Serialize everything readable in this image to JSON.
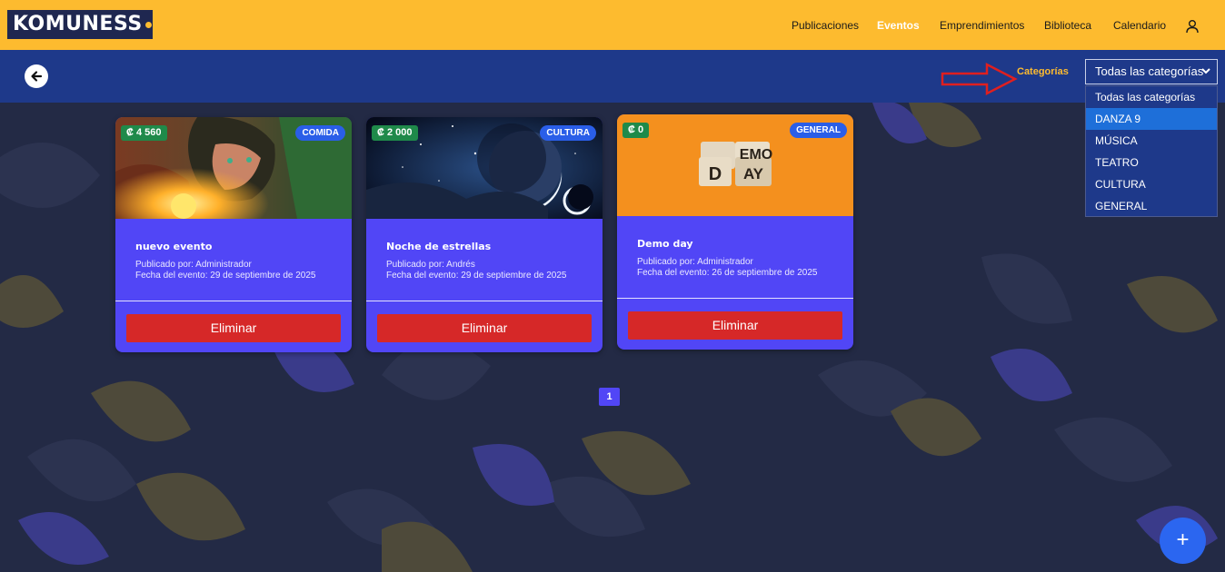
{
  "brand": {
    "logo_text": "KOMUNESS"
  },
  "nav": {
    "items": [
      "Publicaciones",
      "Eventos",
      "Emprendimientos",
      "Biblioteca",
      "Calendario"
    ],
    "active": "Eventos"
  },
  "filter": {
    "label": "Categorías",
    "selected": "Todas las categorías",
    "options": [
      "Todas las categorías",
      "DANZA 9",
      "MÚSICA",
      "TEATRO",
      "CULTURA",
      "GENERAL"
    ],
    "highlighted": "DANZA 9"
  },
  "events": [
    {
      "price": "₡ 4 560",
      "category": "COMIDA",
      "title": "nuevo evento",
      "published_by": "Publicado por: Administrador",
      "date": "Fecha del evento: 29 de septiembre de 2025",
      "delete_label": "Eliminar"
    },
    {
      "price": "₡ 2 000",
      "category": "CULTURA",
      "title": "Noche de estrellas",
      "published_by": "Publicado por: Andrés",
      "date": "Fecha del evento: 29 de septiembre de 2025",
      "delete_label": "Eliminar"
    },
    {
      "price": "₡ 0",
      "category": "GENERAL",
      "title": "Demo day",
      "published_by": "Publicado por: Administrador",
      "date": "Fecha del evento: 26 de septiembre de 2025",
      "delete_label": "Eliminar",
      "image_text": {
        "top": "EMO",
        "left": "D",
        "right": "AY"
      }
    }
  ],
  "pagination": {
    "current": "1"
  },
  "fab_label": "+",
  "colors": {
    "header": "#fdbb2f",
    "subbar": "#1e398a",
    "card": "#5146f6",
    "danger": "#d62828",
    "price_badge": "#1f8a4a",
    "category_badge": "#2a5ee8",
    "fab": "#2b66f0"
  },
  "icons": {
    "back": "arrow-left-icon",
    "user": "user-icon",
    "chevron": "chevron-down-icon",
    "annotation": "red-arrow-annotation"
  }
}
